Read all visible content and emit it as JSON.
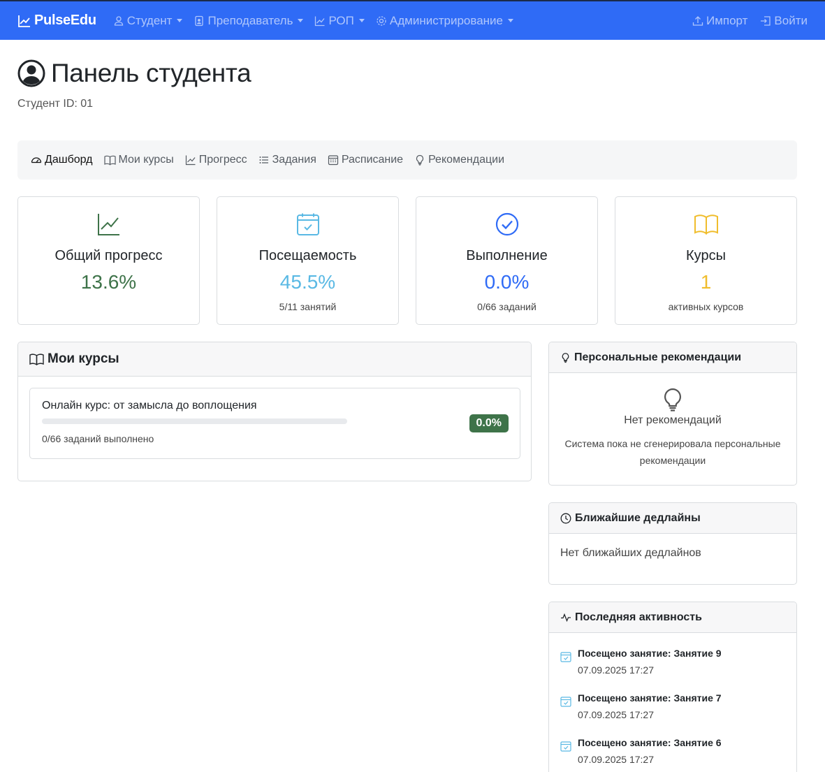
{
  "colors": {
    "navbar_bg": "#2f6bf6",
    "progress_green": "#3e7349",
    "attendance_cyan": "#5ab9e4",
    "completion_blue": "#2f6bf6",
    "courses_yellow": "#f0bd2c"
  },
  "navbar": {
    "brand": "PulseEdu",
    "brand_icon": "graph-up-icon",
    "items": [
      {
        "label": "Студент",
        "icon": "person-icon"
      },
      {
        "label": "Преподаватель",
        "icon": "person-badge-icon"
      },
      {
        "label": "РОП",
        "icon": "graph-up-icon"
      },
      {
        "label": "Администрирование",
        "icon": "gear-icon"
      }
    ],
    "import_label": "Импорт",
    "login_label": "Войти"
  },
  "header": {
    "title": "Панель студента",
    "student_id": "Студент ID: 01"
  },
  "tabs": [
    {
      "label": "Дашборд",
      "icon": "speedometer-icon",
      "active": true
    },
    {
      "label": "Мои курсы",
      "icon": "book-icon",
      "active": false
    },
    {
      "label": "Прогресс",
      "icon": "graph-up-icon",
      "active": false
    },
    {
      "label": "Задания",
      "icon": "list-icon",
      "active": false
    },
    {
      "label": "Расписание",
      "icon": "calendar-icon",
      "active": false
    },
    {
      "label": "Рекомендации",
      "icon": "lightbulb-icon",
      "active": false
    }
  ],
  "stats": [
    {
      "title": "Общий прогресс",
      "value": "13.6%",
      "sub": ""
    },
    {
      "title": "Посещаемость",
      "value": "45.5%",
      "sub": "5/11 занятий"
    },
    {
      "title": "Выполнение",
      "value": "0.0%",
      "sub": "0/66 заданий"
    },
    {
      "title": "Курсы",
      "value": "1",
      "sub": "активных курсов"
    }
  ],
  "courses": {
    "title": "Мои курсы",
    "items": [
      {
        "name": "Онлайн курс: от замысла до воплощения",
        "progress": 0.0,
        "summary": "0/66 заданий выполнено",
        "badge": "0.0%"
      }
    ]
  },
  "recommendations": {
    "title": "Персональные рекомендации",
    "empty_title": "Нет рекомендаций",
    "empty_text": "Система пока не сгенерировала персональные рекомендации"
  },
  "deadlines": {
    "title": "Ближайшие дедлайны",
    "empty_text": "Нет ближайших дедлайнов"
  },
  "activity": {
    "title": "Последняя активность",
    "items": [
      {
        "title": "Посещено занятие: Занятие 9",
        "date": "07.09.2025 17:27"
      },
      {
        "title": "Посещено занятие: Занятие 7",
        "date": "07.09.2025 17:27"
      },
      {
        "title": "Посещено занятие: Занятие 6",
        "date": "07.09.2025 17:27"
      }
    ]
  }
}
